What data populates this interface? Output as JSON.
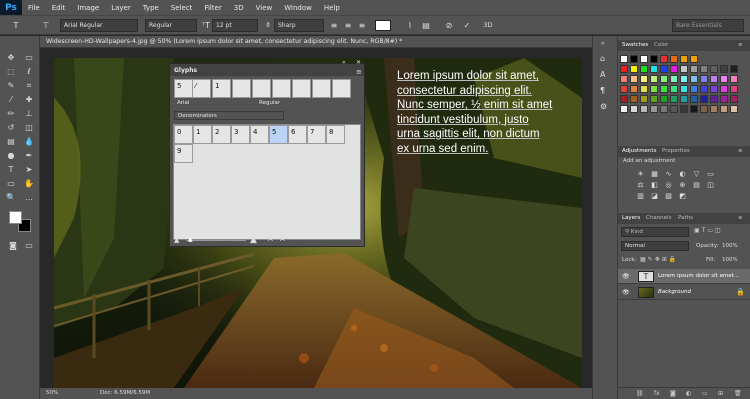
{
  "app": {
    "logo": "Ps"
  },
  "menu": [
    "File",
    "Edit",
    "Image",
    "Layer",
    "Type",
    "Select",
    "Filter",
    "3D",
    "View",
    "Window",
    "Help"
  ],
  "options_bar": {
    "font_family": "Arial Regular",
    "font_style": "Regular",
    "font_size": "12 pt",
    "antialias": "Sharp",
    "workspace": "Bare Essentials",
    "threed_label": "3D"
  },
  "document": {
    "tab_title": "Widescreen-HD-Wallpapers-4.jpg @ 50% (Lorem ipsum dolor sit amet,  consectetur adipiscing elit.  Nunc, RGB/8#) *",
    "text_layer_content": [
      "Lorem ipsum dolor sit amet,",
      "consectetur adipiscing elit.",
      "Nunc semper, ½ enim sit amet",
      "tincidunt vestibulum, justo",
      "urna sagittis elit, non dictum",
      "ex urna sed enim."
    ],
    "zoom": "50%",
    "doc_size": "Doc: 6.59M/6.59M"
  },
  "glyphs_panel": {
    "title": "Glyphs",
    "recent": [
      "5",
      "⁄",
      "1"
    ],
    "font": "Arial",
    "style": "Regular",
    "category": "Denominators",
    "glyphs": [
      "0",
      "1",
      "2",
      "3",
      "4",
      "5",
      "6",
      "7",
      "8",
      "9"
    ],
    "selected_index": 5
  },
  "swatches_panel": {
    "tabs": [
      "Swatches",
      "Color"
    ],
    "colors": [
      "#ffffff",
      "#000000",
      "#ffffff",
      "#000000",
      "#e83030",
      "#e86a10",
      "#f0a000",
      "#f0a000",
      "#e82020",
      "#f0f000",
      "#20e020",
      "#20e0e0",
      "#2040f0",
      "#e020e0",
      "#c8c8c8",
      "#a0a0a0",
      "#808080",
      "#606060",
      "#404040",
      "#202020",
      "#f08080",
      "#f8c080",
      "#f8f080",
      "#c0f080",
      "#80f080",
      "#80f0c0",
      "#80f0f0",
      "#80c0f0",
      "#8080f0",
      "#c080f0",
      "#f080f0",
      "#f080c0",
      "#e04040",
      "#e08040",
      "#e0e040",
      "#80e040",
      "#40e040",
      "#40e080",
      "#40e0e0",
      "#4080e0",
      "#4040e0",
      "#8040e0",
      "#e040e0",
      "#e04080",
      "#a02020",
      "#a06020",
      "#a0a020",
      "#60a020",
      "#20a020",
      "#20a060",
      "#20a0a0",
      "#2060a0",
      "#2020a0",
      "#6020a0",
      "#a020a0",
      "#a02060",
      "#f0f0f0",
      "#d8d8d8",
      "#b8b8b8",
      "#989898",
      "#787878",
      "#585858",
      "#383838",
      "#181818",
      "#806040",
      "#a08060",
      "#c0a080",
      "#e0c0a0"
    ]
  },
  "adjustments_panel": {
    "tabs": [
      "Adjustments",
      "Properties"
    ],
    "add_label": "Add an adjustment",
    "icons": [
      "brightness-icon",
      "levels-icon",
      "curves-icon",
      "exposure-icon",
      "vibrance-icon",
      "hue-icon",
      "color-balance-icon",
      "bw-icon",
      "photo-filter-icon",
      "channel-mixer-icon",
      "color-lookup-icon",
      "invert-icon",
      "posterize-icon",
      "threshold-icon",
      "gradient-map-icon",
      "selective-color-icon"
    ],
    "icon_glyphs": [
      "☀",
      "▦",
      "∿",
      "◐",
      "▽",
      "▭",
      "⚖",
      "◧",
      "◎",
      "⊕",
      "▤",
      "◫",
      "▥",
      "◪",
      "▧",
      "◩"
    ]
  },
  "layers_panel": {
    "tabs": [
      "Layers",
      "Channels",
      "Paths"
    ],
    "kind_label": "Kind",
    "blend_mode": "Normal",
    "opacity_label": "Opacity:",
    "opacity": "100%",
    "lock_label": "Lock:",
    "fill_label": "Fill:",
    "fill": "100%",
    "layers": [
      {
        "name": "Lorem ipsum dolor sit amet...",
        "type": "text",
        "selected": true
      },
      {
        "name": "Background",
        "type": "image",
        "selected": false
      }
    ]
  },
  "colors": {
    "ui_bg": "#535353",
    "panel_dark": "#424242",
    "selection_blue": "#bcd3f8",
    "ps_blue": "#31a8ff"
  }
}
